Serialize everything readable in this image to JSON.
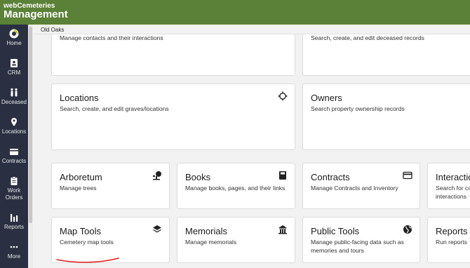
{
  "header": {
    "line1": "webCemeteries",
    "line2": "Management"
  },
  "breadcrumb": "Old Oaks",
  "nav": [
    {
      "label": "Home",
      "icon": "home-icon"
    },
    {
      "label": "CRM",
      "icon": "contacts-icon"
    },
    {
      "label": "Deceased",
      "icon": "people-icon"
    },
    {
      "label": "Locations",
      "icon": "location-pin-icon"
    },
    {
      "label": "Contracts",
      "icon": "credit-card-icon"
    },
    {
      "label1": "Work",
      "label2": "Orders",
      "icon": "clipboard-icon"
    },
    {
      "label": "Reports",
      "icon": "bar-chart-icon"
    },
    {
      "label": "More",
      "icon": "more-icon"
    }
  ],
  "cards": {
    "crm": {
      "desc": "Manage contacts and their interactions"
    },
    "deceased": {
      "desc": "Search, create, and edit deceased records"
    },
    "locations": {
      "title": "Locations",
      "desc": "Search, create, and edit graves/locations",
      "icon": "crosshair-icon"
    },
    "owners": {
      "title": "Owners",
      "desc": "Search property ownership records"
    },
    "arboretum": {
      "title": "Arboretum",
      "desc": "Manage trees",
      "icon": "tree-icon"
    },
    "books": {
      "title": "Books",
      "desc": "Manage books, pages, and their links",
      "icon": "book-icon"
    },
    "contracts": {
      "title": "Contracts",
      "desc": "Manage Contracts and Inventory",
      "icon": "credit-card-icon"
    },
    "interactions": {
      "title": "Interactions",
      "desc": "Search for contact interactions"
    },
    "maptools": {
      "title": "Map Tools",
      "desc": "Cemetery map tools",
      "icon": "layers-icon"
    },
    "memorials": {
      "title": "Memorials",
      "desc": "Manage memorials",
      "icon": "monument-icon"
    },
    "publictools": {
      "title": "Public Tools",
      "desc": "Manage public-facing data such as memories and tours",
      "icon": "globe-icon"
    },
    "reports": {
      "title": "Reports",
      "desc": "Run reports"
    }
  },
  "colors": {
    "topbar": "#5b8037",
    "sidebar": "#2a3041",
    "annotation": "#e0201c"
  }
}
